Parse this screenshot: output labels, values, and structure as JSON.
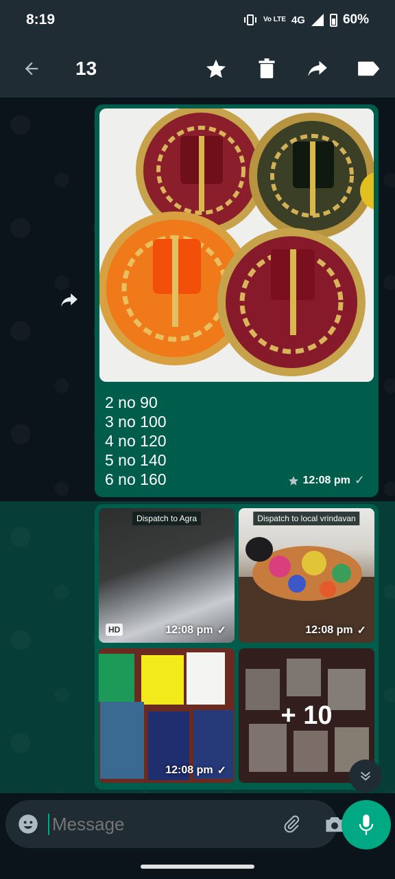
{
  "status_bar": {
    "time": "8:19",
    "network_volte": "Vo LTE",
    "network": "4G",
    "battery": "60%"
  },
  "app_bar": {
    "selected_count": "13",
    "icons": [
      "back-arrow-icon",
      "star-icon",
      "delete-icon",
      "forward-icon",
      "label-icon"
    ]
  },
  "messages": {
    "first": {
      "caption_lines": [
        "2 no 90",
        "3 no 100",
        "4 no 120",
        "5 no 140",
        "6 no 160"
      ],
      "time": "12:08 pm",
      "starred": true
    },
    "album": {
      "tiles": [
        {
          "label": "Dispatch to Agra",
          "time": "12:08 pm",
          "badge": "HD"
        },
        {
          "label": "Dispatch to local vrindavan",
          "time": "12:08 pm"
        },
        {
          "label": "",
          "time": "12:08 pm"
        },
        {
          "label": "",
          "more": "+ 10"
        }
      ]
    }
  },
  "composer": {
    "placeholder": "Message"
  },
  "colors": {
    "bubble": "#005c4b",
    "accent": "#00a884",
    "bar": "#1f2c34",
    "background": "#0b141a"
  }
}
